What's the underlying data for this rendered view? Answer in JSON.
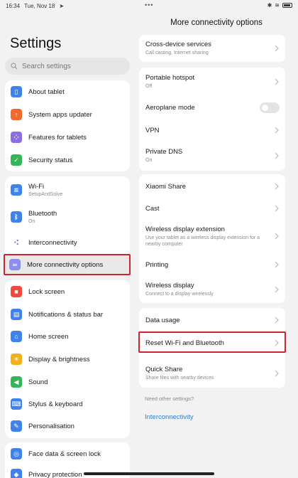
{
  "status_bar": {
    "time": "16:34",
    "date": "Tue, Nov 18",
    "center_dots": "•••"
  },
  "left": {
    "title": "Settings",
    "search_placeholder": "Search settings",
    "groups": [
      {
        "items": [
          {
            "label": "About tablet",
            "icon": "tablet-icon",
            "color": "#3f83ea",
            "glyph": "▯"
          },
          {
            "label": "System apps updater",
            "icon": "arrow-up-icon",
            "color": "#f06a2d",
            "glyph": "↑"
          },
          {
            "label": "Features for tablets",
            "icon": "grid-icon",
            "color": "#8e6ddf",
            "glyph": "⁘"
          },
          {
            "label": "Security status",
            "icon": "shield-check-icon",
            "color": "#35b55a",
            "glyph": "✓"
          }
        ]
      },
      {
        "items": [
          {
            "label": "Wi-Fi",
            "sub": "SetupAndSolve",
            "icon": "wifi-icon",
            "color": "#3f83ea",
            "glyph": "≋"
          },
          {
            "label": "Bluetooth",
            "sub": "On",
            "icon": "bluetooth-icon",
            "color": "#3f83ea",
            "glyph": "ᛒ"
          },
          {
            "label": "Interconnectivity",
            "icon": "interconnectivity-icon",
            "color": "#ffffff",
            "glyph": "⁖"
          },
          {
            "label": "More connectivity options",
            "icon": "link-icon",
            "color": "#8e8ef0",
            "glyph": "∞"
          }
        ]
      },
      {
        "items": [
          {
            "label": "Lock screen",
            "icon": "lock-icon",
            "color": "#f04a3a",
            "glyph": "■"
          },
          {
            "label": "Notifications & status bar",
            "icon": "notification-icon",
            "color": "#3f83ea",
            "glyph": "▤"
          },
          {
            "label": "Home screen",
            "icon": "home-icon",
            "color": "#3f83ea",
            "glyph": "⌂"
          },
          {
            "label": "Display & brightness",
            "icon": "sun-icon",
            "color": "#f2b11c",
            "glyph": "☀"
          },
          {
            "label": "Sound",
            "icon": "speaker-icon",
            "color": "#35b55a",
            "glyph": "◀"
          },
          {
            "label": "Stylus & keyboard",
            "icon": "keyboard-icon",
            "color": "#3f83ea",
            "glyph": "⌨"
          },
          {
            "label": "Personalisation",
            "icon": "brush-icon",
            "color": "#3f83ea",
            "glyph": "✎"
          }
        ]
      },
      {
        "items": [
          {
            "label": "Face data & screen lock",
            "icon": "face-id-icon",
            "color": "#3f83ea",
            "glyph": "◎"
          },
          {
            "label": "Privacy protection",
            "icon": "privacy-icon",
            "color": "#3f83ea",
            "glyph": "◆"
          }
        ]
      }
    ]
  },
  "right": {
    "title": "More connectivity options",
    "groups": [
      {
        "items": [
          {
            "label": "Cross-device services",
            "sub": "Call casting, Internet sharing",
            "control": "chevron"
          }
        ]
      },
      {
        "items": [
          {
            "label": "Portable hotspot",
            "sub": "Off",
            "control": "chevron"
          },
          {
            "label": "Aeroplane mode",
            "control": "toggle",
            "toggle_state": "off"
          },
          {
            "label": "VPN",
            "control": "chevron"
          },
          {
            "label": "Private DNS",
            "sub": "On",
            "control": "chevron"
          }
        ]
      },
      {
        "items": [
          {
            "label": "Xiaomi Share",
            "control": "chevron"
          },
          {
            "label": "Cast",
            "control": "chevron"
          },
          {
            "label": "Wireless display extension",
            "sub": "Use your tablet as a wireless display extension for a nearby computer",
            "control": "chevron"
          },
          {
            "label": "Printing",
            "control": "chevron"
          },
          {
            "label": "Wireless display",
            "sub": "Connect to a display wirelessly",
            "control": "chevron"
          }
        ]
      },
      {
        "items": [
          {
            "label": "Data usage",
            "control": "chevron"
          },
          {
            "label": "Reset Wi-Fi and Bluetooth",
            "control": "chevron"
          },
          {
            "label": "Quick Share",
            "sub": "Share files with nearby devices",
            "control": "chevron"
          }
        ]
      }
    ],
    "need_other": "Need other settings?",
    "interconnectivity_link": "Interconnectivity",
    "accent_color": "#2e7dd6",
    "highlight_color": "#d0232f"
  }
}
